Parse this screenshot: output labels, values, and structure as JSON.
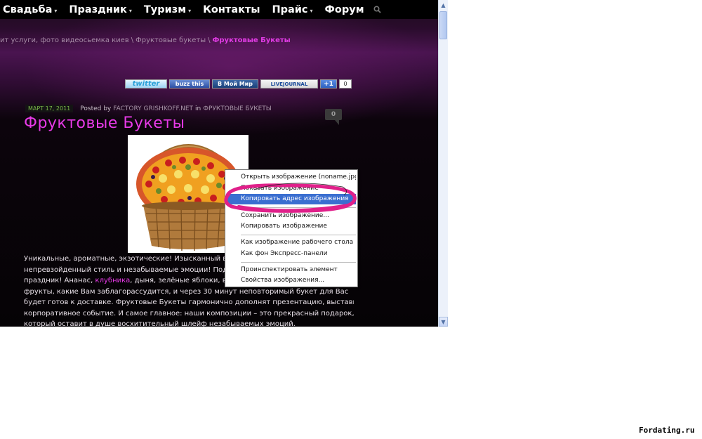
{
  "nav": {
    "items": [
      "Свадьба",
      "Праздник",
      "Туризм",
      "Контакты",
      "Прайс",
      "Форум"
    ],
    "dropdown": [
      true,
      true,
      true,
      false,
      true,
      false
    ],
    "caret": "▾",
    "search_icon": "search-icon"
  },
  "breadcrumb": {
    "items": [
      "ит услуги, фото видеосьемка киев",
      "Фруктовые букеты"
    ],
    "separator": "\\",
    "current": "Фруктовые Букеты"
  },
  "share": {
    "twitter": "twitter",
    "buzz": "buzz this",
    "moimir": "В Мой Мир",
    "livejournal": "LIVEJOURNAL",
    "plusone": "+1",
    "count": "0"
  },
  "post": {
    "date": "МАРТ 17, 2011",
    "posted_by": "Posted by",
    "author": "FACTORY GRISHKOFF.NET",
    "in": "in",
    "category": "ФРУКТОВЫЕ БУКЕТЫ",
    "comments": "0",
    "title": "Фруктовые Букеты",
    "body": {
      "line1": "Уникальные, ароматные, экзотические! Изысканный вку",
      "line2": "непревзойденный стиль и незабываемые эмоции! Подар",
      "line3_a": "праздник! Ананас, ",
      "line3_link": "клубника",
      "line3_b": ", дыня, зелёные яблоки, вин",
      "line4": "фрукты, какие Вам заблагорассудится, и через 30 минут неповторимый букет для Вас",
      "line5": "будет готов к доставке. Фруктовые Букеты гармонично дополнят презентацию, выставку,",
      "line6": "корпоративное событие. И самое главное: наши композиции – это прекрасный подарок,",
      "line7": "который оставит в душе восхитительный шлейф незабываемых эмоций."
    }
  },
  "context_menu": {
    "items": [
      "Открыть изображение (noname.jpg)",
      "Показать изображение",
      "Копировать адрес изображения",
      "Сохранить изображение...",
      "Копировать изображение",
      "Как изображение рабочего стола",
      "Как фон Экспресс-панели",
      "Проинспектировать элемент",
      "Свойства изображения..."
    ],
    "highlighted_index": 2,
    "highlight_color": "#3a6ed0"
  },
  "annotation_color": "#e0208a",
  "accent_color": "#e83ae8",
  "watermark": "Fordating.ru"
}
